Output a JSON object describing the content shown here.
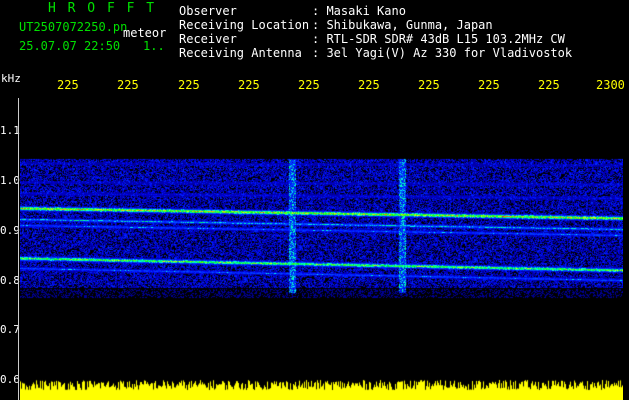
{
  "header": {
    "title": "H R O F F T",
    "filename": "UT2507072250.pn",
    "mode": "meteor",
    "date": "25.07.07 22:50",
    "page": "1.."
  },
  "info": {
    "labels": [
      "Observer",
      "Receiving Location",
      "Receiver",
      "Receiving Antenna"
    ],
    "values": [
      ": Masaki Kano",
      ": Shibukawa, Gunma, Japan",
      ": RTL-SDR SDR# 43dB L15 103.2MHz CW",
      ": 3el Yagi(V) Az 330 for Vladivostok"
    ]
  },
  "axis": {
    "unit": "kHz",
    "time_labels": [
      "225",
      "225",
      "225",
      "225",
      "225",
      "225",
      "225",
      "225",
      "225",
      "2300"
    ],
    "freq_labels": [
      "1.1",
      "1.0",
      "0.9",
      "0.8",
      "0.7",
      "0.6"
    ]
  },
  "colors": {
    "header_green": "#00e000",
    "time_label_yellow": "#ffff00",
    "amplitude_yellow": "#ffff00",
    "background": "#000000"
  }
}
